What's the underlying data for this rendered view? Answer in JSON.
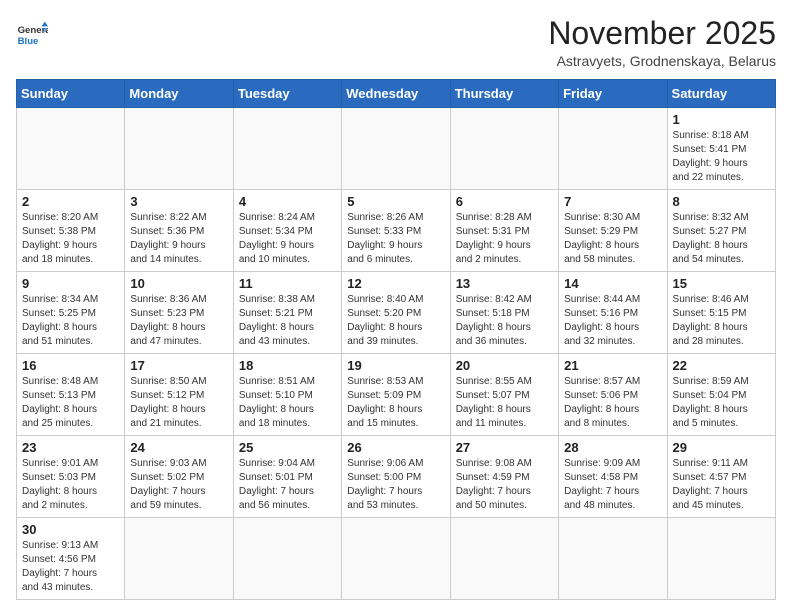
{
  "header": {
    "logo_general": "General",
    "logo_blue": "Blue",
    "month": "November 2025",
    "location": "Astravyets, Grodnenskaya, Belarus"
  },
  "days_of_week": [
    "Sunday",
    "Monday",
    "Tuesday",
    "Wednesday",
    "Thursday",
    "Friday",
    "Saturday"
  ],
  "weeks": [
    [
      {
        "day": "",
        "text": ""
      },
      {
        "day": "",
        "text": ""
      },
      {
        "day": "",
        "text": ""
      },
      {
        "day": "",
        "text": ""
      },
      {
        "day": "",
        "text": ""
      },
      {
        "day": "",
        "text": ""
      },
      {
        "day": "1",
        "text": "Sunrise: 8:18 AM\nSunset: 5:41 PM\nDaylight: 9 hours\nand 22 minutes."
      }
    ],
    [
      {
        "day": "2",
        "text": "Sunrise: 8:20 AM\nSunset: 5:38 PM\nDaylight: 9 hours\nand 18 minutes."
      },
      {
        "day": "3",
        "text": "Sunrise: 8:22 AM\nSunset: 5:36 PM\nDaylight: 9 hours\nand 14 minutes."
      },
      {
        "day": "4",
        "text": "Sunrise: 8:24 AM\nSunset: 5:34 PM\nDaylight: 9 hours\nand 10 minutes."
      },
      {
        "day": "5",
        "text": "Sunrise: 8:26 AM\nSunset: 5:33 PM\nDaylight: 9 hours\nand 6 minutes."
      },
      {
        "day": "6",
        "text": "Sunrise: 8:28 AM\nSunset: 5:31 PM\nDaylight: 9 hours\nand 2 minutes."
      },
      {
        "day": "7",
        "text": "Sunrise: 8:30 AM\nSunset: 5:29 PM\nDaylight: 8 hours\nand 58 minutes."
      },
      {
        "day": "8",
        "text": "Sunrise: 8:32 AM\nSunset: 5:27 PM\nDaylight: 8 hours\nand 54 minutes."
      }
    ],
    [
      {
        "day": "9",
        "text": "Sunrise: 8:34 AM\nSunset: 5:25 PM\nDaylight: 8 hours\nand 51 minutes."
      },
      {
        "day": "10",
        "text": "Sunrise: 8:36 AM\nSunset: 5:23 PM\nDaylight: 8 hours\nand 47 minutes."
      },
      {
        "day": "11",
        "text": "Sunrise: 8:38 AM\nSunset: 5:21 PM\nDaylight: 8 hours\nand 43 minutes."
      },
      {
        "day": "12",
        "text": "Sunrise: 8:40 AM\nSunset: 5:20 PM\nDaylight: 8 hours\nand 39 minutes."
      },
      {
        "day": "13",
        "text": "Sunrise: 8:42 AM\nSunset: 5:18 PM\nDaylight: 8 hours\nand 36 minutes."
      },
      {
        "day": "14",
        "text": "Sunrise: 8:44 AM\nSunset: 5:16 PM\nDaylight: 8 hours\nand 32 minutes."
      },
      {
        "day": "15",
        "text": "Sunrise: 8:46 AM\nSunset: 5:15 PM\nDaylight: 8 hours\nand 28 minutes."
      }
    ],
    [
      {
        "day": "16",
        "text": "Sunrise: 8:48 AM\nSunset: 5:13 PM\nDaylight: 8 hours\nand 25 minutes."
      },
      {
        "day": "17",
        "text": "Sunrise: 8:50 AM\nSunset: 5:12 PM\nDaylight: 8 hours\nand 21 minutes."
      },
      {
        "day": "18",
        "text": "Sunrise: 8:51 AM\nSunset: 5:10 PM\nDaylight: 8 hours\nand 18 minutes."
      },
      {
        "day": "19",
        "text": "Sunrise: 8:53 AM\nSunset: 5:09 PM\nDaylight: 8 hours\nand 15 minutes."
      },
      {
        "day": "20",
        "text": "Sunrise: 8:55 AM\nSunset: 5:07 PM\nDaylight: 8 hours\nand 11 minutes."
      },
      {
        "day": "21",
        "text": "Sunrise: 8:57 AM\nSunset: 5:06 PM\nDaylight: 8 hours\nand 8 minutes."
      },
      {
        "day": "22",
        "text": "Sunrise: 8:59 AM\nSunset: 5:04 PM\nDaylight: 8 hours\nand 5 minutes."
      }
    ],
    [
      {
        "day": "23",
        "text": "Sunrise: 9:01 AM\nSunset: 5:03 PM\nDaylight: 8 hours\nand 2 minutes."
      },
      {
        "day": "24",
        "text": "Sunrise: 9:03 AM\nSunset: 5:02 PM\nDaylight: 7 hours\nand 59 minutes."
      },
      {
        "day": "25",
        "text": "Sunrise: 9:04 AM\nSunset: 5:01 PM\nDaylight: 7 hours\nand 56 minutes."
      },
      {
        "day": "26",
        "text": "Sunrise: 9:06 AM\nSunset: 5:00 PM\nDaylight: 7 hours\nand 53 minutes."
      },
      {
        "day": "27",
        "text": "Sunrise: 9:08 AM\nSunset: 4:59 PM\nDaylight: 7 hours\nand 50 minutes."
      },
      {
        "day": "28",
        "text": "Sunrise: 9:09 AM\nSunset: 4:58 PM\nDaylight: 7 hours\nand 48 minutes."
      },
      {
        "day": "29",
        "text": "Sunrise: 9:11 AM\nSunset: 4:57 PM\nDaylight: 7 hours\nand 45 minutes."
      }
    ],
    [
      {
        "day": "30",
        "text": "Sunrise: 9:13 AM\nSunset: 4:56 PM\nDaylight: 7 hours\nand 43 minutes."
      },
      {
        "day": "",
        "text": ""
      },
      {
        "day": "",
        "text": ""
      },
      {
        "day": "",
        "text": ""
      },
      {
        "day": "",
        "text": ""
      },
      {
        "day": "",
        "text": ""
      },
      {
        "day": "",
        "text": ""
      }
    ]
  ]
}
